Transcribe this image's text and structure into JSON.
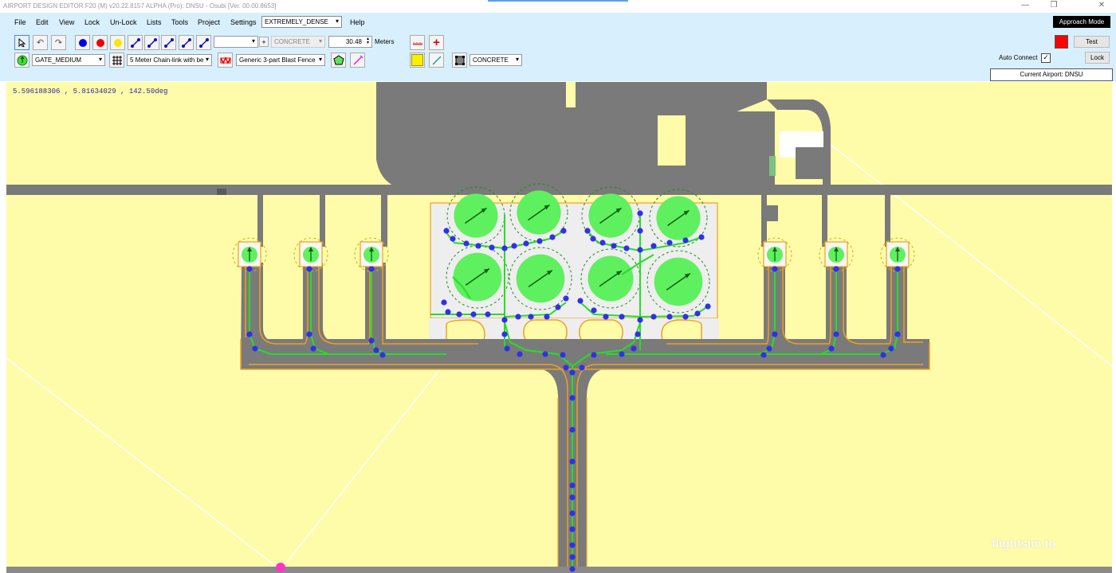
{
  "window": {
    "title": "AIRPORT DESIGN EDITOR F20 (M) v20.22.8157 ALPHA (Pro): DNSU - Osubi [Ver. 00.00.8653]"
  },
  "menu": {
    "items": [
      "File",
      "Edit",
      "View",
      "Lock",
      "Un-Lock",
      "Lists",
      "Tools",
      "Project",
      "Settings",
      "Help"
    ],
    "density_value": "EXTREMELY_DENSE",
    "approach_mode_label": "Approach Mode"
  },
  "toolbar": {
    "tool_icons": [
      "select-arrow-icon",
      "undo-icon",
      "redo-icon",
      "blue-node-icon",
      "red-node-icon",
      "yellow-node-icon",
      "taxi-link-t-icon",
      "taxi-link-a-icon",
      "taxi-link-r-icon",
      "taxi-link-c-icon",
      "taxi-link-v-icon"
    ],
    "surface_combo": "",
    "surface_value": "CONCRETE",
    "width_value": "30.48",
    "width_unit": "Meters",
    "gate_value": "GATE_MEDIUM",
    "fence_value": "5 Meter Chain-link with be",
    "blast_fence_value": "Generic 3-part Blast Fence",
    "apron_surface_value": "CONCRETE",
    "auto_connect_label": "Auto Connect",
    "auto_connect_checked": true,
    "test_label": "Test",
    "lock_label": "Lock",
    "current_airport": "Current Airport: DNSU",
    "indicator_color": "#ff0000"
  },
  "map": {
    "coordinates": "5.596188306 , 5.81634029 , 142.50deg",
    "watermark": "flightsim.to",
    "colors": {
      "ground": "#fefca8",
      "pavement": "#7a7a7a",
      "apron": "#eeeeee",
      "parking_circle": "#5ff05f",
      "node": "#3030e8",
      "route_link": "#22e022",
      "edge_line": "#f0a020"
    },
    "large_stands": 8,
    "small_stands": 6
  }
}
